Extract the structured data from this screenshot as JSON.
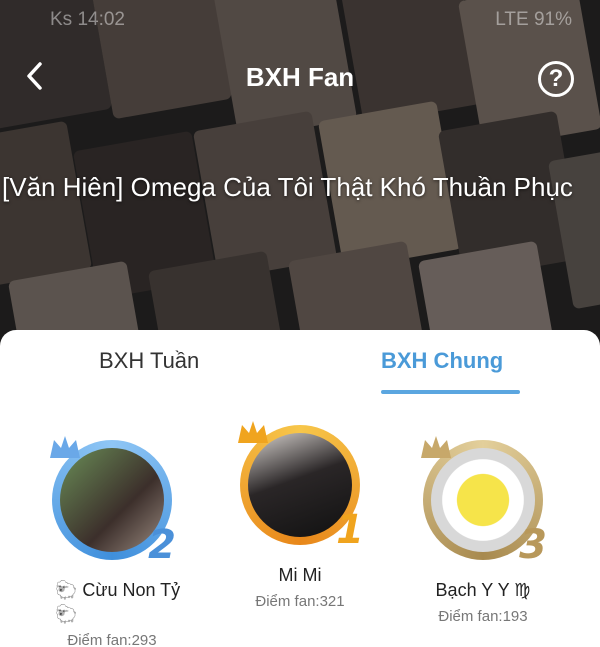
{
  "statusbar": {
    "time": "Ks 14:02",
    "right": "LTE 91%"
  },
  "header": {
    "title": "BXH Fan",
    "back_icon": "chevron-left-icon",
    "help_icon": "question-circle-icon",
    "help_glyph": "?"
  },
  "story": {
    "title": "[Văn Hiên] Omega Của Tôi Thật Khó Thuần Phục"
  },
  "tabs": [
    {
      "label": "BXH Tuần",
      "active": false
    },
    {
      "label": "BXH Chung",
      "active": true
    }
  ],
  "fans": [
    {
      "rank": "2",
      "name": "🐑 Cừu Non Tỷ 🐑",
      "score": "Điểm fan:293"
    },
    {
      "rank": "1",
      "name": "Mi Mi",
      "score": "Điểm fan:321"
    },
    {
      "rank": "3",
      "name": "Bạch Y Y ♍",
      "score": "Điểm fan:193"
    }
  ],
  "colors": {
    "accent": "#4a9ad8",
    "gold": "#f0a41e",
    "silver": "#6aa8e8",
    "bronze": "#c7a86a"
  }
}
